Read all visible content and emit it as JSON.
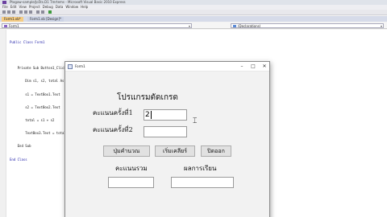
{
  "ide": {
    "title": "Ptogaw-sample/Jo5ts.D1 Tmrtems - Microsoft Visual Basic 2010 Express",
    "menu": [
      "File",
      "Edit",
      "View",
      "Project",
      "Debug",
      "Data",
      "Window",
      "Help"
    ],
    "tabs": {
      "active": "Form1.vb*",
      "other": "Form1.vb [Design]*"
    },
    "class_combo": "Form1",
    "method_combo": "(Declarations)",
    "code_lines": [
      "Public Class Form1",
      "",
      "    Private Sub Button1_Click(ByVal sender As System.Object, ByVal e As System.EventArgs) Handles Button1.Click",
      "        Dim s1, s2, total As Single",
      "        s1 = TextBox1.Text",
      "        s2 = TextBox2.Text",
      "        total = s1 + s2",
      "        TextBox3.Text = total",
      "    End Sub",
      "End Class"
    ]
  },
  "form": {
    "title": "Form1",
    "heading": "โปรแกรมตัดเกรด",
    "label_score1": "คะแนนครั้งที่1",
    "label_score2": "คะแนนครั้งที่2",
    "input_score1_value": "2",
    "input_score2_value": "",
    "button_calculate": "ปุ่มคำนวณ",
    "button_new": "เริ่มเคลียร์",
    "button_exit": "ปิดออก",
    "label_total": "คะแนนรวม",
    "label_result": "ผลการเรียน",
    "input_total_value": "",
    "input_result_value": ""
  },
  "window_controls": {
    "minimize": "–",
    "maximize": "□",
    "close": "✕"
  }
}
